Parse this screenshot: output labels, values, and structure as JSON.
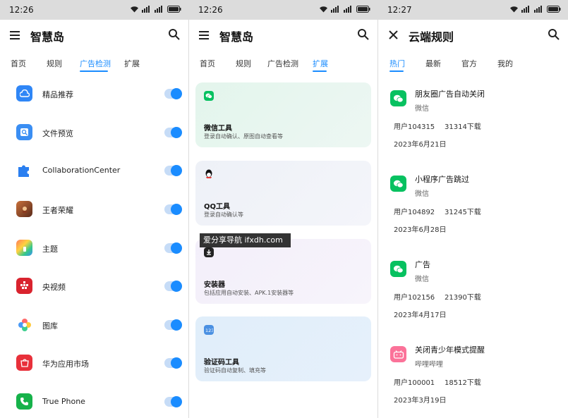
{
  "colors": {
    "accent": "#1a8cff",
    "wechat_green": "#07c160"
  },
  "watermark": "爱分享导航 ifxdh.com",
  "panel1": {
    "status_time": "12:26",
    "title": "智慧岛",
    "tabs": [
      {
        "label": "首页",
        "active": false
      },
      {
        "label": "规则",
        "active": false
      },
      {
        "label": "广告检测",
        "active": true
      },
      {
        "label": "扩展",
        "active": false
      }
    ],
    "items": [
      {
        "label": "精品推荐",
        "icon": "app-store-icon",
        "enabled": true
      },
      {
        "label": "文件预览",
        "icon": "file-preview-icon",
        "enabled": true
      },
      {
        "label": "CollaborationCenter",
        "icon": "puzzle-icon",
        "enabled": true
      },
      {
        "label": "王者荣耀",
        "icon": "game-icon",
        "enabled": true
      },
      {
        "label": "主题",
        "icon": "theme-icon",
        "enabled": true
      },
      {
        "label": "央视频",
        "icon": "video-icon",
        "enabled": true
      },
      {
        "label": "图库",
        "icon": "gallery-icon",
        "enabled": true
      },
      {
        "label": "华为应用市场",
        "icon": "app-market-icon",
        "enabled": true
      },
      {
        "label": "True Phone",
        "icon": "phone-icon",
        "enabled": true
      }
    ]
  },
  "panel2": {
    "status_time": "12:26",
    "title": "智慧岛",
    "tabs": [
      {
        "label": "首页",
        "active": false
      },
      {
        "label": "规则",
        "active": false
      },
      {
        "label": "广告检测",
        "active": false
      },
      {
        "label": "扩展",
        "active": true
      }
    ],
    "cards": [
      {
        "title": "微信工具",
        "desc": "登录自动确认、原图自动查看等",
        "icon": "wechat-icon"
      },
      {
        "title": "QQ工具",
        "desc": "登录自动确认等",
        "icon": "qq-icon"
      },
      {
        "title": "安装器",
        "desc": "包括应用自动安装、APK.1安装器等",
        "icon": "installer-icon"
      },
      {
        "title": "验证码工具",
        "desc": "验证码自动复制、填充等",
        "icon": "verification-code-icon"
      }
    ]
  },
  "panel3": {
    "status_time": "12:27",
    "title": "云端规则",
    "tabs": [
      {
        "label": "热门",
        "active": true
      },
      {
        "label": "最新",
        "active": false
      },
      {
        "label": "官方",
        "active": false
      },
      {
        "label": "我的",
        "active": false
      }
    ],
    "rules": [
      {
        "name": "朋友圈广告自动关闭",
        "author": "微信",
        "user": "用户104315",
        "downloads": "31314下载",
        "date": "2023年6月21日",
        "icon": "wechat-icon"
      },
      {
        "name": "小程序广告跳过",
        "author": "微信",
        "user": "用户104892",
        "downloads": "31245下载",
        "date": "2023年6月28日",
        "icon": "wechat-icon"
      },
      {
        "name": "广告",
        "author": "微信",
        "user": "用户102156",
        "downloads": "21390下载",
        "date": "2023年4月17日",
        "icon": "wechat-icon"
      },
      {
        "name": "关闭青少年模式提醒",
        "author": "哔哩哔哩",
        "user": "用户100001",
        "downloads": "18512下载",
        "date": "2023年3月19日",
        "icon": "bilibili-icon"
      }
    ]
  }
}
